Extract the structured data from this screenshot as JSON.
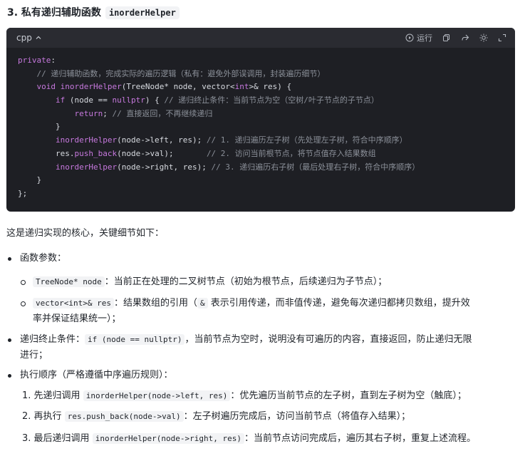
{
  "heading": {
    "prefix": "3. 私有递归辅助函数",
    "code": "inorderHelper"
  },
  "codebox": {
    "language": "cpp",
    "run_label": "运行",
    "lines": [
      "private:",
      "    // 递归辅助函数，完成实际的遍历逻辑（私有：避免外部误调用，封装遍历细节）",
      "    void inorderHelper(TreeNode* node, vector<int>& res) {",
      "        if (node == nullptr) { // 递归终止条件：当前节点为空（空树/叶子节点的子节点）",
      "            return; // 直接返回，不再继续递归",
      "        }",
      "        inorderHelper(node->left, res); // 1. 递归遍历左子树（先处理左子树，符合中序顺序）",
      "        res.push_back(node->val);       // 2. 访问当前根节点，将节点值存入结果数组",
      "        inorderHelper(node->right, res); // 3. 递归遍历右子树（最后处理右子树，符合中序顺序）",
      "    }",
      "};"
    ]
  },
  "intro": "这是递归实现的核心，关键细节如下：",
  "bullets": {
    "b1": "函数参数：",
    "b1_sub1_code": "TreeNode* node",
    "b1_sub1_text": "：当前正在处理的二叉树节点（初始为根节点，后续递归为子节点）；",
    "b1_sub2_code": "vector<int>& res",
    "b1_sub2_text_a": "：结果数组的引用（",
    "b1_sub2_code2": "&",
    "b1_sub2_text_b": " 表示引用传递，而非值传递，避免每次递归都拷贝数组，提升效",
    "b1_sub2_text_c": "率并保证结果统一）；",
    "b2_text_a": "递归终止条件：",
    "b2_code": "if (node == nullptr)",
    "b2_text_b": "，当前节点为空时，说明没有可遍历的内容，直接返回，防止递归无限",
    "b2_text_c": "进行；",
    "b3": "执行顺序（严格遵循中序遍历规则）：",
    "o1_num": "1.",
    "o1_a": "先递归调用",
    "o1_code": "inorderHelper(node->left, res)",
    "o1_b": "：优先遍历当前节点的左子树，直到左子树为空（触底）；",
    "o2_num": "2.",
    "o2_a": "再执行",
    "o2_code": "res.push_back(node->val)",
    "o2_b": "：左子树遍历完成后，访问当前节点（将值存入结果）；",
    "o3_num": "3.",
    "o3_a": "最后递归调用",
    "o3_code": "inorderHelper(node->right, res)",
    "o3_b": "：当前节点访问完成后，遍历其右子树，重复上述流程。"
  }
}
